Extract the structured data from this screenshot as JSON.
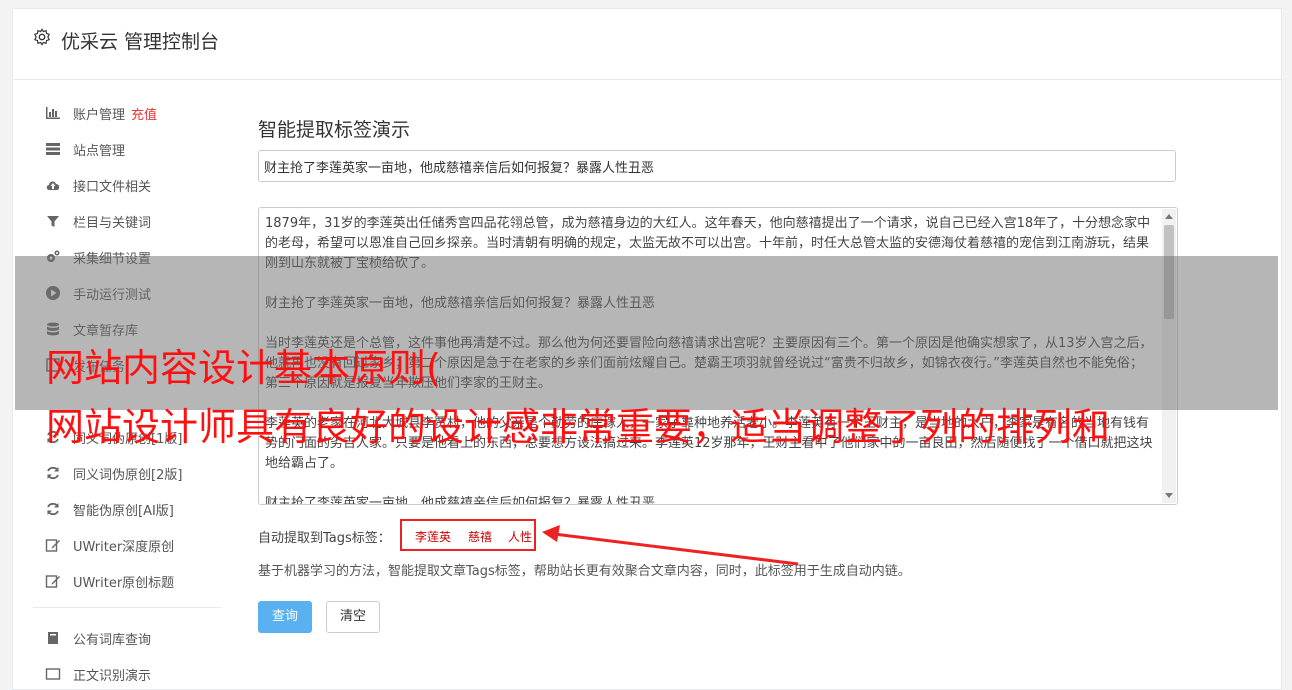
{
  "header": {
    "title": "优采云 管理控制台"
  },
  "sidebar": {
    "items": [
      {
        "label": "账户管理",
        "extra": "充值",
        "icon": "bar-chart-icon"
      },
      {
        "label": "站点管理",
        "icon": "server-icon"
      },
      {
        "label": "接口文件相关",
        "icon": "cloud-upload-icon"
      },
      {
        "label": "栏目与关键词",
        "icon": "filter-icon"
      },
      {
        "label": "采集细节设置",
        "icon": "gears-icon"
      },
      {
        "label": "手动运行测试",
        "icon": "play-icon"
      },
      {
        "label": "文章暂存库",
        "icon": "database-icon"
      },
      {
        "label": "发布任务",
        "icon": "task-icon"
      },
      {
        "label": "同义词伪原创[1版]",
        "icon": "refresh-icon"
      },
      {
        "label": "同义词伪原创[2版]",
        "icon": "refresh-icon"
      },
      {
        "label": "智能伪原创[AI版]",
        "icon": "refresh-icon"
      },
      {
        "label": "UWriter深度原创",
        "icon": "edit-icon"
      },
      {
        "label": "UWriter原创标题",
        "icon": "edit-icon"
      },
      {
        "label": "公有词库查询",
        "icon": "book-icon"
      },
      {
        "label": "正文识别演示",
        "icon": "window-icon"
      }
    ]
  },
  "main": {
    "title": "智能提取标签演示",
    "title_input_value": "财主抢了李莲英家一亩地，他成慈禧亲信后如何报复？暴露人性丑恶",
    "content_paragraphs": [
      "1879年，31岁的李莲英出任储秀宫四品花翎总管，成为慈禧身边的大红人。这年春天，他向慈禧提出了一个请求，说自己已经入宫18年了，十分想念家中的老母，希望可以恩准自己回乡探亲。当时清朝有明确的规定，太监无故不可以出宫。十年前，时任大总管太监的安德海仗着慈禧的宠信到江南游玩，结果刚到山东就被丁宝桢给砍了。",
      "财主抢了李莲英家一亩地，他成慈禧亲信后如何报复？暴露人性丑恶",
      "当时李莲英还是个总管，这件事他再清楚不过。那么他为何还要冒险向慈禧请求出宫呢？主要原因有三个。第一个原因是他确实想家了，从13岁入宫之后，他就再也没有回过家乡；第二个原因是急于在老家的乡亲们面前炫耀自己。楚霸王项羽就曾经说过“富贵不归故乡，如锦衣夜行。”李莲英自然也不能免俗；第三个原因就是报复当年欺压他们李家的王财主。",
      "李莲英的老家在河北大城县李贾村，他的父亲是个勤劳的庄稼人，一家子靠种地养活老小。李莲英有一个王财主，是当地的大户，李家是有名的当地有钱有势的门面的劣吉人家。只要是他看上的东西，总要想方设法搞过来。李莲英12岁那年，王财主看中了他们家中的一亩良田，然后随便找了一个借口就把这块地给霸占了。",
      "财主抢了李莲英家一亩地，他成慈禧亲信后如何报复？暴露人性丑恶"
    ],
    "tags_label": "自动提取到Tags标签：",
    "tags": [
      "李莲英",
      "慈禧",
      "人性"
    ],
    "description": "基于机器学习的方法，智能提取文章Tags标签，帮助站长更有效聚合文章内容，同时，此标签用于生成自动内链。",
    "query_button": "查询",
    "clear_button": "清空"
  },
  "overlay": {
    "line1": "网站内容设计基本原则(",
    "line2": "网站设计师具有良好的设计感非常重要，适当调整了列的排列和"
  },
  "colors": {
    "accent": "#5ab1ef",
    "tag_red": "#cc0000",
    "overlay_text": "#ff1010"
  }
}
